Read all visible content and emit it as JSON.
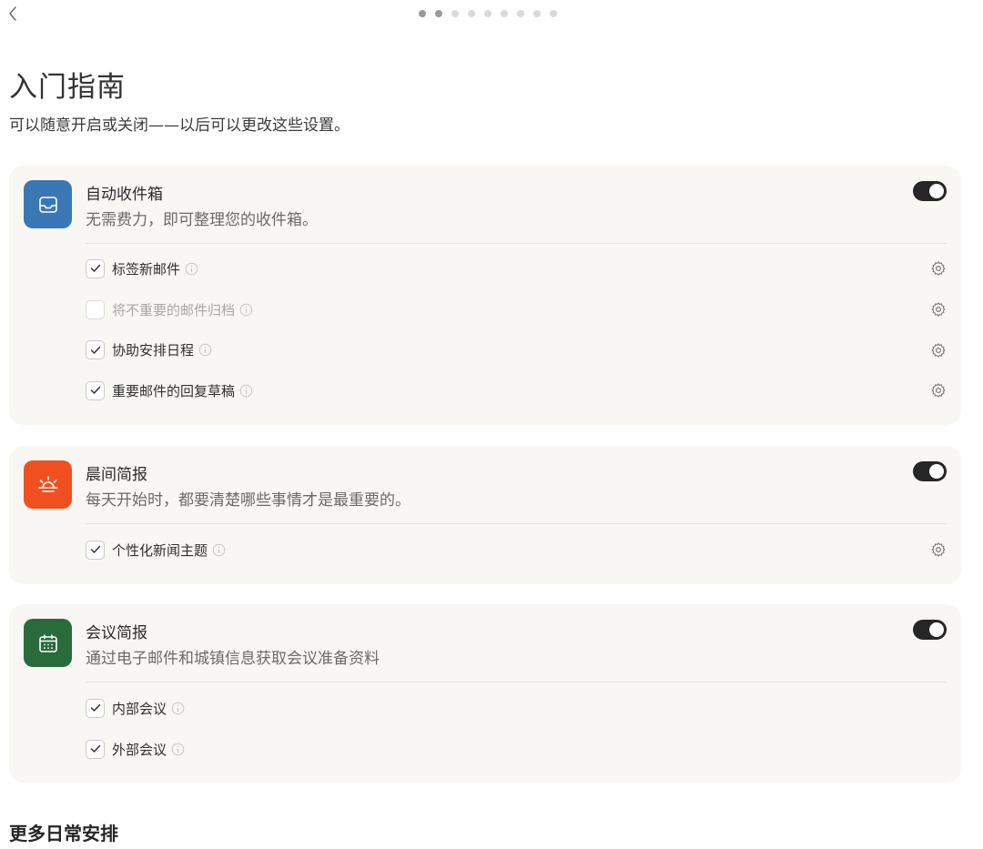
{
  "header": {
    "title": "入门指南",
    "subtitle": "可以随意开启或关闭——以后可以更改这些设置。"
  },
  "pager": {
    "total": 9,
    "current": 2
  },
  "cards": [
    {
      "icon": "inbox-icon",
      "color": "#3a78b5",
      "title": "自动收件箱",
      "desc": "无需费力，即可整理您的收件箱。",
      "enabled": true,
      "options": [
        {
          "label": "标签新邮件",
          "checked": true,
          "settings": true
        },
        {
          "label": "将不重要的邮件归档",
          "checked": false,
          "settings": true
        },
        {
          "label": "协助安排日程",
          "checked": true,
          "settings": true
        },
        {
          "label": "重要邮件的回复草稿",
          "checked": true,
          "settings": true
        }
      ]
    },
    {
      "icon": "sunrise-icon",
      "color": "#f0501f",
      "title": "晨间简报",
      "desc": "每天开始时，都要清楚哪些事情才是最重要的。",
      "enabled": true,
      "options": [
        {
          "label": "个性化新闻主题",
          "checked": true,
          "settings": true
        }
      ]
    },
    {
      "icon": "calendar-icon",
      "color": "#2a6b3b",
      "title": "会议简报",
      "desc": "通过电子邮件和城镇信息获取会议准备资料",
      "enabled": true,
      "options": [
        {
          "label": "内部会议",
          "checked": true,
          "settings": false
        },
        {
          "label": "外部会议",
          "checked": true,
          "settings": false
        }
      ]
    }
  ],
  "more_section": {
    "title": "更多日常安排"
  }
}
